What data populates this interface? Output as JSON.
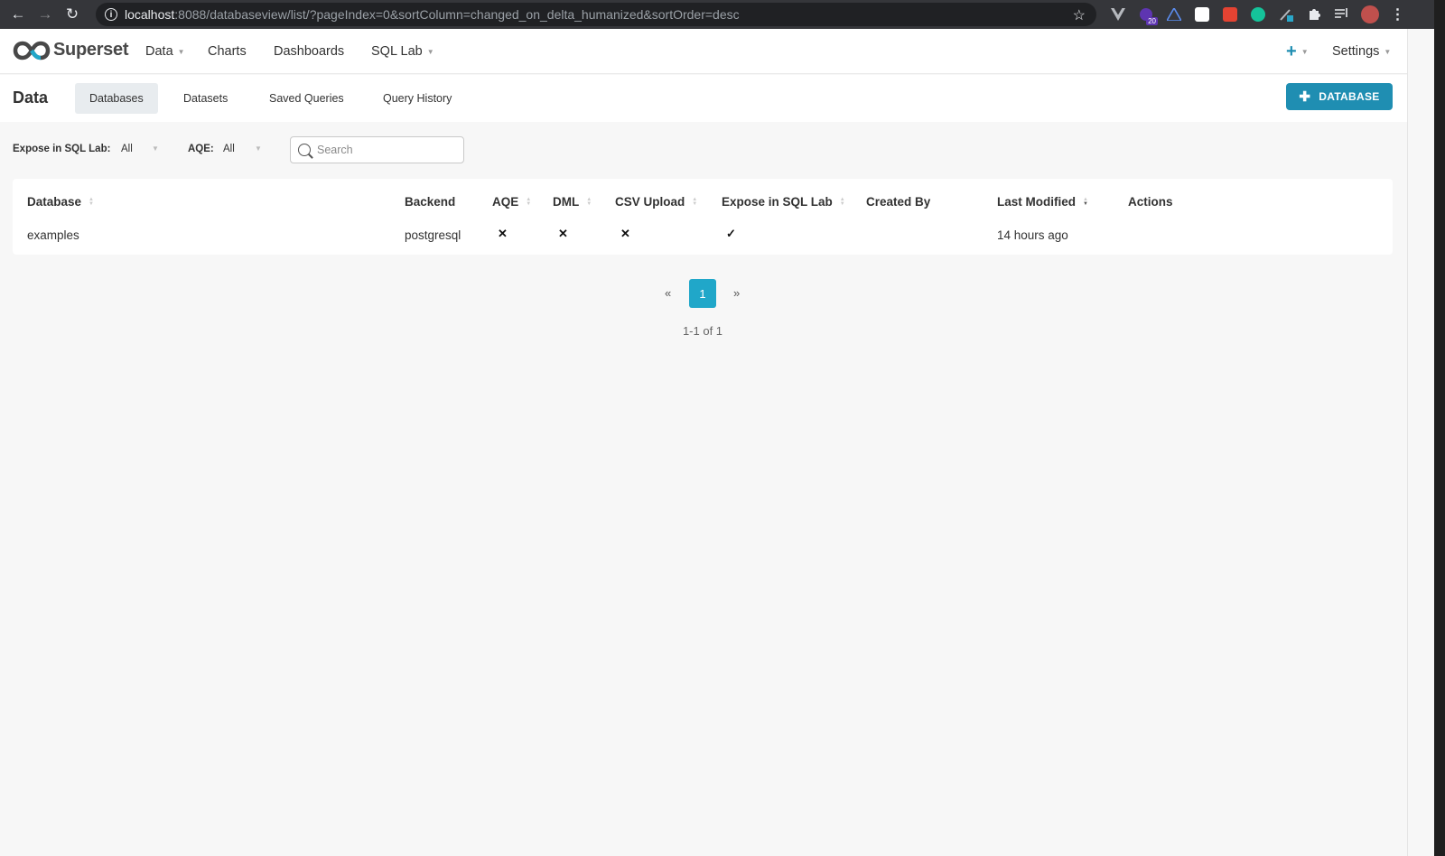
{
  "browser": {
    "url_host": "localhost",
    "url_rest": ":8088/databaseview/list/?pageIndex=0&sortColumn=changed_on_delta_humanized&sortOrder=desc",
    "extension_badge": "20"
  },
  "app": {
    "brand": "Superset",
    "menu": {
      "data": "Data",
      "charts": "Charts",
      "dashboards": "Dashboards",
      "sql_lab": "SQL Lab",
      "settings": "Settings",
      "plus": "+"
    }
  },
  "subnav": {
    "title": "Data",
    "tabs": [
      "Databases",
      "Datasets",
      "Saved Queries",
      "Query History"
    ],
    "active_tab": "Databases",
    "add_button": "DATABASE"
  },
  "filters": {
    "expose_label": "Expose in SQL Lab:",
    "expose_value": "All",
    "aqe_label": "AQE:",
    "aqe_value": "All",
    "search_placeholder": "Search"
  },
  "table": {
    "columns": [
      "Database",
      "Backend",
      "AQE",
      "DML",
      "CSV Upload",
      "Expose in SQL Lab",
      "Created By",
      "Last Modified",
      "Actions"
    ],
    "rows": [
      {
        "database": "examples",
        "backend": "postgresql",
        "aqe": "✕",
        "dml": "✕",
        "csv_upload": "✕",
        "expose_in_sql_lab": "✓",
        "created_by": "",
        "last_modified": "14 hours ago"
      }
    ]
  },
  "pagination": {
    "prev": "«",
    "current": "1",
    "next": "»",
    "info": "1-1 of 1"
  },
  "colors": {
    "primary": "#1f8eb2",
    "page_active": "#20a7c9"
  }
}
